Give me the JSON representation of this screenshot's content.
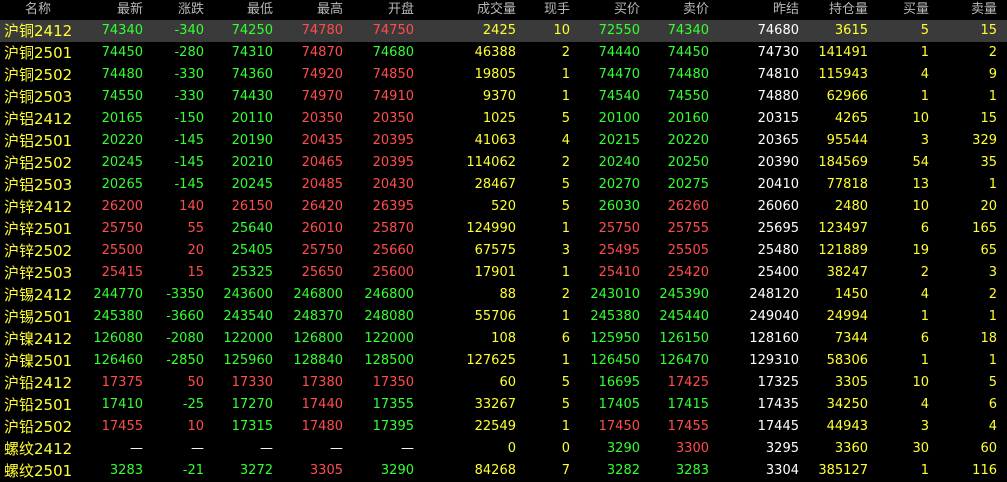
{
  "headers": [
    "名称",
    "最新",
    "涨跌",
    "最低",
    "最高",
    "开盘",
    "成交量",
    "现手",
    "买价",
    "卖价",
    "昨结",
    "持仓量",
    "买量",
    "卖量"
  ],
  "rows": [
    {
      "name": "沪铜2412",
      "cells": [
        "74340",
        "-340",
        "74250",
        "74780",
        "74750",
        "2425",
        "10",
        "72550",
        "74340",
        "74680",
        "3615",
        "5",
        "15"
      ],
      "colors": [
        "g",
        "g",
        "g",
        "r",
        "r",
        "y",
        "y",
        "g",
        "g",
        "w",
        "y",
        "y",
        "y"
      ],
      "selected": true
    },
    {
      "name": "沪铜2501",
      "cells": [
        "74450",
        "-280",
        "74310",
        "74870",
        "74680",
        "46388",
        "2",
        "74440",
        "74450",
        "74730",
        "141491",
        "1",
        "2"
      ],
      "colors": [
        "g",
        "g",
        "g",
        "r",
        "g",
        "y",
        "y",
        "g",
        "g",
        "w",
        "y",
        "y",
        "y"
      ]
    },
    {
      "name": "沪铜2502",
      "cells": [
        "74480",
        "-330",
        "74360",
        "74920",
        "74850",
        "19805",
        "1",
        "74470",
        "74480",
        "74810",
        "115943",
        "4",
        "9"
      ],
      "colors": [
        "g",
        "g",
        "g",
        "r",
        "r",
        "y",
        "y",
        "g",
        "g",
        "w",
        "y",
        "y",
        "y"
      ]
    },
    {
      "name": "沪铜2503",
      "cells": [
        "74550",
        "-330",
        "74430",
        "74970",
        "74910",
        "9370",
        "1",
        "74540",
        "74550",
        "74880",
        "62966",
        "1",
        "1"
      ],
      "colors": [
        "g",
        "g",
        "g",
        "r",
        "r",
        "y",
        "y",
        "g",
        "g",
        "w",
        "y",
        "y",
        "y"
      ]
    },
    {
      "name": "沪铝2412",
      "cells": [
        "20165",
        "-150",
        "20110",
        "20350",
        "20350",
        "1025",
        "5",
        "20100",
        "20160",
        "20315",
        "4265",
        "10",
        "15"
      ],
      "colors": [
        "g",
        "g",
        "g",
        "r",
        "r",
        "y",
        "y",
        "g",
        "g",
        "w",
        "y",
        "y",
        "y"
      ]
    },
    {
      "name": "沪铝2501",
      "cells": [
        "20220",
        "-145",
        "20190",
        "20435",
        "20395",
        "41063",
        "4",
        "20215",
        "20220",
        "20365",
        "95544",
        "3",
        "329"
      ],
      "colors": [
        "g",
        "g",
        "g",
        "r",
        "r",
        "y",
        "y",
        "g",
        "g",
        "w",
        "y",
        "y",
        "y"
      ]
    },
    {
      "name": "沪铝2502",
      "cells": [
        "20245",
        "-145",
        "20210",
        "20465",
        "20395",
        "114062",
        "2",
        "20240",
        "20250",
        "20390",
        "184569",
        "54",
        "35"
      ],
      "colors": [
        "g",
        "g",
        "g",
        "r",
        "r",
        "y",
        "y",
        "g",
        "g",
        "w",
        "y",
        "y",
        "y"
      ]
    },
    {
      "name": "沪铝2503",
      "cells": [
        "20265",
        "-145",
        "20245",
        "20485",
        "20430",
        "28467",
        "5",
        "20270",
        "20275",
        "20410",
        "77818",
        "13",
        "1"
      ],
      "colors": [
        "g",
        "g",
        "g",
        "r",
        "r",
        "y",
        "y",
        "g",
        "g",
        "w",
        "y",
        "y",
        "y"
      ]
    },
    {
      "name": "沪锌2412",
      "cells": [
        "26200",
        "140",
        "26150",
        "26420",
        "26395",
        "520",
        "5",
        "26030",
        "26260",
        "26060",
        "2480",
        "10",
        "20"
      ],
      "colors": [
        "r",
        "r",
        "r",
        "r",
        "r",
        "y",
        "y",
        "g",
        "r",
        "w",
        "y",
        "y",
        "y"
      ]
    },
    {
      "name": "沪锌2501",
      "cells": [
        "25750",
        "55",
        "25640",
        "26010",
        "25870",
        "124990",
        "1",
        "25750",
        "25755",
        "25695",
        "123497",
        "6",
        "165"
      ],
      "colors": [
        "r",
        "r",
        "g",
        "r",
        "r",
        "y",
        "y",
        "r",
        "r",
        "w",
        "y",
        "y",
        "y"
      ]
    },
    {
      "name": "沪锌2502",
      "cells": [
        "25500",
        "20",
        "25405",
        "25750",
        "25660",
        "67575",
        "3",
        "25495",
        "25505",
        "25480",
        "121889",
        "19",
        "65"
      ],
      "colors": [
        "r",
        "r",
        "g",
        "r",
        "r",
        "y",
        "y",
        "r",
        "r",
        "w",
        "y",
        "y",
        "y"
      ]
    },
    {
      "name": "沪锌2503",
      "cells": [
        "25415",
        "15",
        "25325",
        "25650",
        "25600",
        "17901",
        "1",
        "25410",
        "25420",
        "25400",
        "38247",
        "2",
        "3"
      ],
      "colors": [
        "r",
        "r",
        "g",
        "r",
        "r",
        "y",
        "y",
        "r",
        "r",
        "w",
        "y",
        "y",
        "y"
      ]
    },
    {
      "name": "沪锡2412",
      "cells": [
        "244770",
        "-3350",
        "243600",
        "246800",
        "246800",
        "88",
        "2",
        "243010",
        "245390",
        "248120",
        "1450",
        "4",
        "2"
      ],
      "colors": [
        "g",
        "g",
        "g",
        "g",
        "g",
        "y",
        "y",
        "g",
        "g",
        "w",
        "y",
        "y",
        "y"
      ]
    },
    {
      "name": "沪锡2501",
      "cells": [
        "245380",
        "-3660",
        "243540",
        "248370",
        "248080",
        "55706",
        "1",
        "245380",
        "245440",
        "249040",
        "24994",
        "1",
        "1"
      ],
      "colors": [
        "g",
        "g",
        "g",
        "g",
        "g",
        "y",
        "y",
        "g",
        "g",
        "w",
        "y",
        "y",
        "y"
      ]
    },
    {
      "name": "沪镍2412",
      "cells": [
        "126080",
        "-2080",
        "122000",
        "126800",
        "122000",
        "108",
        "6",
        "125950",
        "126150",
        "128160",
        "7344",
        "6",
        "18"
      ],
      "colors": [
        "g",
        "g",
        "g",
        "g",
        "g",
        "y",
        "y",
        "g",
        "g",
        "w",
        "y",
        "y",
        "y"
      ]
    },
    {
      "name": "沪镍2501",
      "cells": [
        "126460",
        "-2850",
        "125960",
        "128840",
        "128500",
        "127625",
        "1",
        "126450",
        "126470",
        "129310",
        "58306",
        "1",
        "1"
      ],
      "colors": [
        "g",
        "g",
        "g",
        "g",
        "g",
        "y",
        "y",
        "g",
        "g",
        "w",
        "y",
        "y",
        "y"
      ]
    },
    {
      "name": "沪铅2412",
      "cells": [
        "17375",
        "50",
        "17330",
        "17380",
        "17350",
        "60",
        "5",
        "16695",
        "17425",
        "17325",
        "3305",
        "10",
        "5"
      ],
      "colors": [
        "r",
        "r",
        "r",
        "r",
        "r",
        "y",
        "y",
        "g",
        "r",
        "w",
        "y",
        "y",
        "y"
      ]
    },
    {
      "name": "沪铅2501",
      "cells": [
        "17410",
        "-25",
        "17270",
        "17440",
        "17355",
        "33267",
        "5",
        "17405",
        "17415",
        "17435",
        "34250",
        "4",
        "6"
      ],
      "colors": [
        "g",
        "g",
        "g",
        "r",
        "g",
        "y",
        "y",
        "g",
        "g",
        "w",
        "y",
        "y",
        "y"
      ]
    },
    {
      "name": "沪铅2502",
      "cells": [
        "17455",
        "10",
        "17315",
        "17480",
        "17395",
        "22549",
        "1",
        "17450",
        "17455",
        "17445",
        "44943",
        "3",
        "4"
      ],
      "colors": [
        "r",
        "r",
        "g",
        "r",
        "g",
        "y",
        "y",
        "r",
        "r",
        "w",
        "y",
        "y",
        "y"
      ]
    },
    {
      "name": "螺纹2412",
      "cells": [
        "—",
        "—",
        "—",
        "—",
        "—",
        "0",
        "0",
        "3290",
        "3300",
        "3295",
        "3360",
        "30",
        "60"
      ],
      "colors": [
        "w",
        "w",
        "w",
        "w",
        "w",
        "y",
        "y",
        "g",
        "r",
        "w",
        "y",
        "y",
        "y"
      ]
    },
    {
      "name": "螺纹2501",
      "cells": [
        "3283",
        "-21",
        "3272",
        "3305",
        "3290",
        "84268",
        "7",
        "3282",
        "3283",
        "3304",
        "385127",
        "1",
        "116"
      ],
      "colors": [
        "g",
        "g",
        "g",
        "r",
        "g",
        "y",
        "y",
        "g",
        "g",
        "w",
        "y",
        "y",
        "y"
      ]
    }
  ]
}
